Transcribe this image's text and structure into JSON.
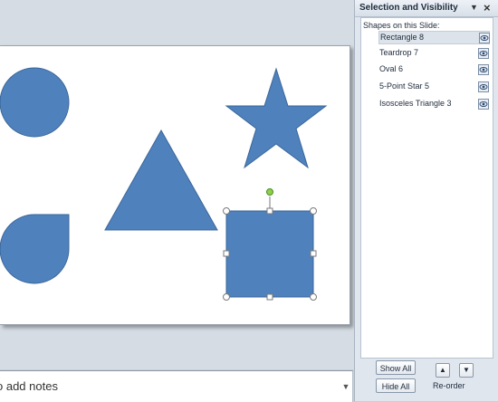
{
  "pane": {
    "title": "Selection and Visibility",
    "list_heading": "Shapes on this Slide:",
    "shapes": [
      {
        "label": "Rectangle 8",
        "selected": true,
        "visible": true
      },
      {
        "label": "Teardrop 7",
        "selected": false,
        "visible": true
      },
      {
        "label": "Oval 6",
        "selected": false,
        "visible": true
      },
      {
        "label": "5-Point Star 5",
        "selected": false,
        "visible": true
      },
      {
        "label": "Isosceles Triangle 3",
        "selected": false,
        "visible": true
      }
    ],
    "show_all_label": "Show All",
    "hide_all_label": "Hide All",
    "reorder_label": "Re-order",
    "dropdown_icon": "chevron-down-icon",
    "close_icon": "close-icon"
  },
  "notes": {
    "placeholder": "o add notes"
  },
  "colors": {
    "shape_fill": "#4f81bd",
    "rotation_handle": "#8bd14a"
  }
}
